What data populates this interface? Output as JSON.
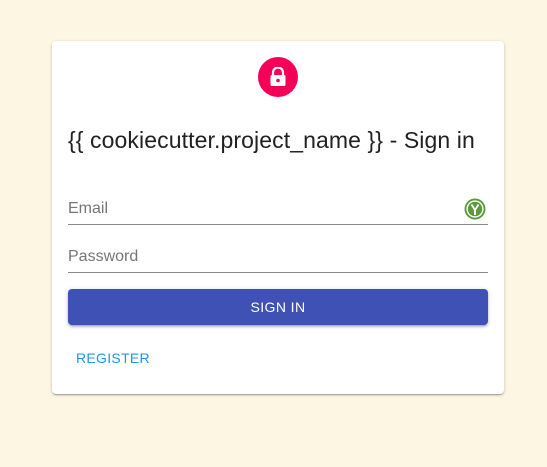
{
  "login": {
    "title": "{{ cookiecutter.project_name }} - Sign in",
    "email_placeholder": "Email",
    "password_placeholder": "Password",
    "email_value": "",
    "password_value": "",
    "signin_label": "Sign in",
    "register_label": "Register"
  },
  "icons": {
    "avatar": "lock-icon",
    "email_extension": "password-manager-icon"
  },
  "colors": {
    "background": "#fdf6e3",
    "avatar": "#f50057",
    "primary_button": "#3f51b5",
    "link": "#2196f3",
    "extension_icon": "#5a9a3b"
  }
}
